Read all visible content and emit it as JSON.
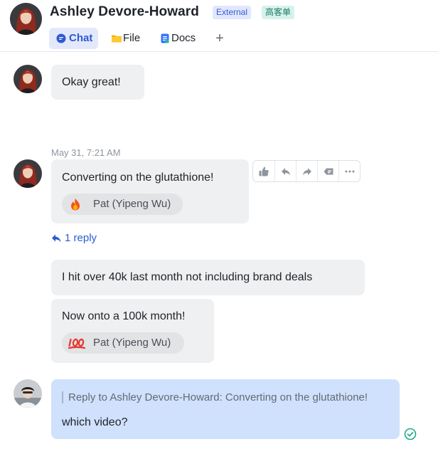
{
  "header": {
    "contact_name": "Ashley Devore-Howard",
    "tag_external": "External",
    "tag_org": "高客单",
    "tabs": [
      {
        "label": "Chat",
        "icon": "chat-bubble-icon",
        "active": true
      },
      {
        "label": "File",
        "icon": "folder-icon",
        "active": false
      },
      {
        "label": "Docs",
        "icon": "docs-icon",
        "active": false
      }
    ],
    "add_tab": "+"
  },
  "messages": {
    "m1": {
      "text": "Okay great!"
    },
    "timestamp": "May 31, 7:21 AM",
    "m2": {
      "text": "Converting on the glutathione!",
      "reaction": {
        "emoji": "fire",
        "by": "Pat (Yipeng Wu)"
      }
    },
    "reply_count": "1 reply",
    "m3": {
      "text": "I hit over 40k last month not including brand deals"
    },
    "m4": {
      "text": "Now onto a 100k month!",
      "reaction": {
        "emoji": "hundred-points",
        "by": "Pat (Yipeng Wu)"
      }
    },
    "m5": {
      "quote": "Reply to Ashley Devore-Howard:  Converting on the glutathione!",
      "text": "which video?"
    }
  },
  "hover_actions": [
    "thumbs-up-icon",
    "reply-icon",
    "forward-icon",
    "tag-icon",
    "more-icon"
  ],
  "colors": {
    "accent": "#2b5ad4",
    "bubble_incoming": "#eff0f1",
    "bubble_outgoing": "#cfe1fd",
    "read_check": "#22a88a"
  }
}
